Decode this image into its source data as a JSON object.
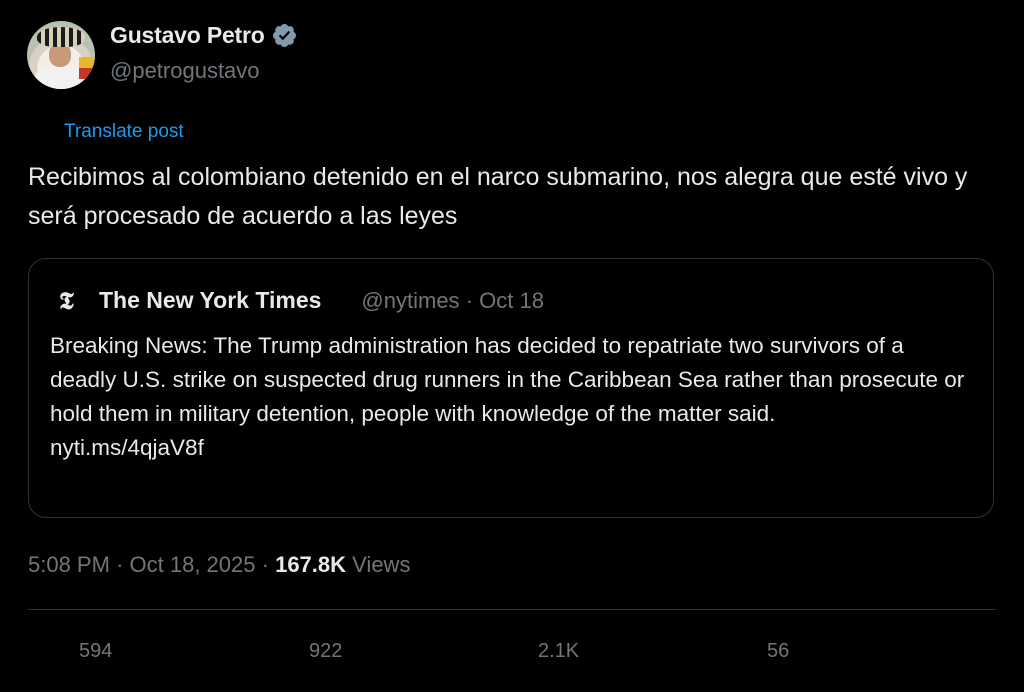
{
  "author": {
    "display_name": "Gustavo Petro",
    "handle": "@petrogustavo",
    "verified": true
  },
  "translate_label": "Translate post",
  "tweet_text": "Recibimos al colombiano detenido en el narco submarino, nos alegra que esté vivo y será procesado de acuerdo a las leyes",
  "quote": {
    "name": "The New York Times",
    "handle": "@nytimes",
    "separator": "·",
    "date": "Oct 18",
    "text": "Breaking News: The Trump administration has decided to repatriate two survivors of a deadly U.S. strike on suspected drug runners in the Caribbean Sea rather than prosecute or hold them in military detention, people with knowledge of the matter said.",
    "link": "nyti.ms/4qjaV8f"
  },
  "meta": {
    "time": "5:08 PM",
    "separator": "·",
    "date": "Oct 18, 2025",
    "views_count": "167.8K",
    "views_label": "Views"
  },
  "actions": {
    "replies": "594",
    "reposts": "922",
    "likes": "2.1K",
    "bookmarks": "56"
  },
  "colors": {
    "background": "#000000",
    "text": "#e7e9ea",
    "secondary": "#71767b",
    "link": "#1d9bf0",
    "border": "#2f3336"
  }
}
